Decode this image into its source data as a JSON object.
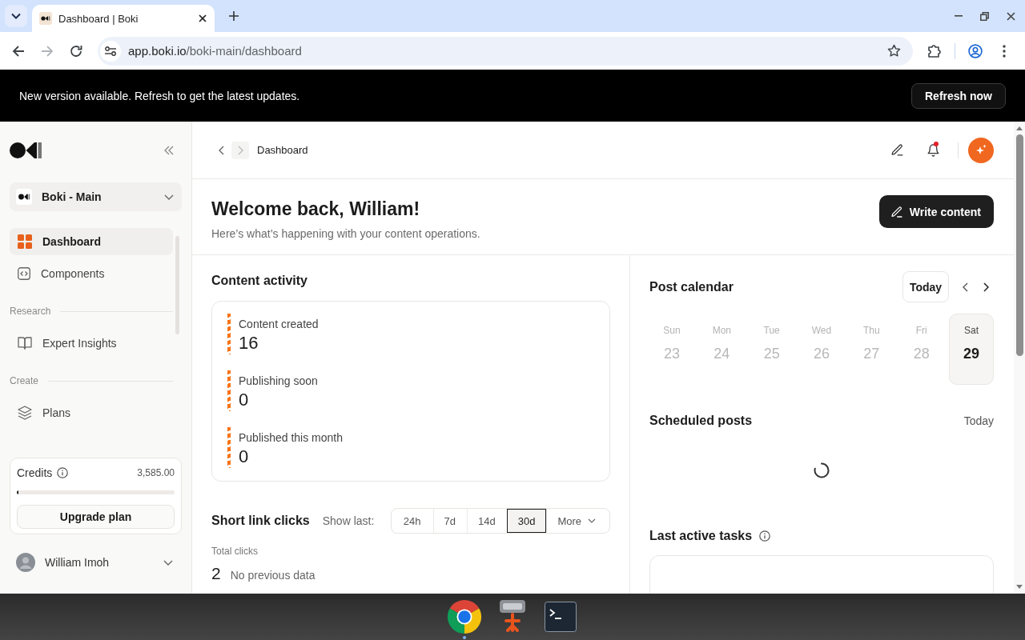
{
  "browser": {
    "tab": {
      "title": "Dashboard | Boki"
    },
    "back": {
      "disabled": false
    },
    "forward": {
      "disabled": true
    },
    "url": {
      "host": "app.boki.io",
      "path": "/boki-main/dashboard"
    }
  },
  "banner": {
    "message": "New version available. Refresh to get the latest updates.",
    "button": "Refresh now"
  },
  "sidebar": {
    "workspace": "Boki - Main",
    "sections": [
      {
        "items": [
          {
            "label": "Dashboard",
            "selected": true
          },
          {
            "label": "Components",
            "selected": false
          }
        ]
      },
      {
        "title": "Research",
        "items": [
          {
            "label": "Expert Insights",
            "selected": false
          }
        ]
      },
      {
        "title": "Create",
        "items": [
          {
            "label": "Plans",
            "selected": false
          }
        ]
      }
    ],
    "credits": {
      "label": "Credits",
      "amount": "3,585.00",
      "level": 0.01,
      "button": "Upgrade plan"
    },
    "user": {
      "name": "William Imoh"
    }
  },
  "header": {
    "breadcrumb": "Dashboard",
    "notifications": {
      "unread": true
    }
  },
  "welcome": {
    "title": "Welcome back, William!",
    "subtitle": "Here’s what’s happening with your content operations.",
    "button": "Write content"
  },
  "content_activity": {
    "title": "Content activity",
    "stats": [
      {
        "label": "Content created",
        "value": "16"
      },
      {
        "label": "Publishing soon",
        "value": "0"
      },
      {
        "label": "Published this month",
        "value": "0"
      }
    ]
  },
  "short_link_clicks": {
    "title": "Short link clicks",
    "filter_label": "Show last:",
    "ranges": [
      {
        "label": "24h",
        "kind": "option",
        "selected": false
      },
      {
        "label": "7d",
        "kind": "option",
        "selected": false
      },
      {
        "label": "14d",
        "kind": "option",
        "selected": false
      },
      {
        "label": "30d",
        "kind": "option",
        "selected": true
      },
      {
        "label": "More",
        "kind": "dropdown",
        "selected": false
      }
    ],
    "total_label": "Total clicks",
    "total": "2",
    "comparison": "No previous data"
  },
  "post_calendar": {
    "title": "Post calendar",
    "today_button": "Today",
    "days": [
      {
        "weekday": "Sun",
        "date": "23",
        "selected": false
      },
      {
        "weekday": "Mon",
        "date": "24",
        "selected": false
      },
      {
        "weekday": "Tue",
        "date": "25",
        "selected": false
      },
      {
        "weekday": "Wed",
        "date": "26",
        "selected": false
      },
      {
        "weekday": "Thu",
        "date": "27",
        "selected": false
      },
      {
        "weekday": "Fri",
        "date": "28",
        "selected": false
      },
      {
        "weekday": "Sat",
        "date": "29",
        "selected": true
      }
    ]
  },
  "scheduled_posts": {
    "title": "Scheduled posts",
    "range": "Today",
    "loading": true
  },
  "last_active_tasks": {
    "title": "Last active tasks"
  },
  "taskbar": {
    "apps": [
      {
        "running": true
      },
      {
        "running": false
      },
      {
        "running": false
      }
    ]
  }
}
